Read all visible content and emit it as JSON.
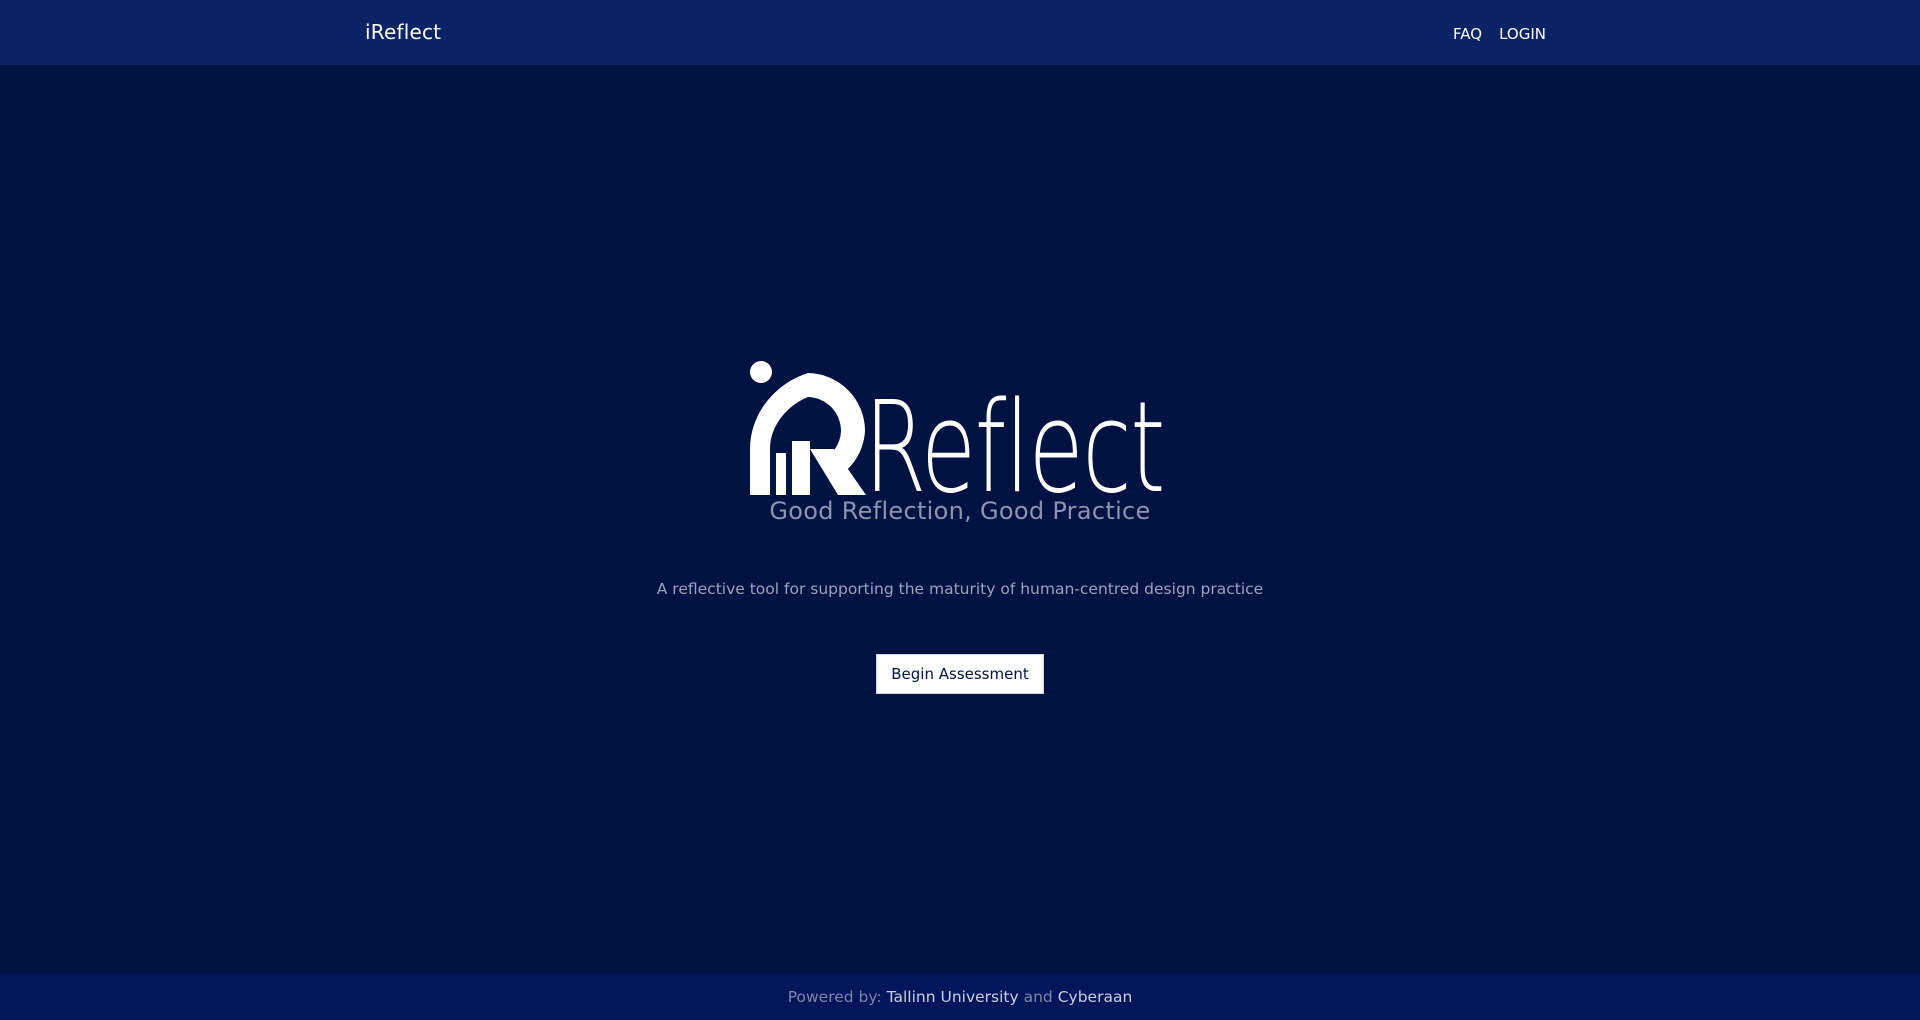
{
  "header": {
    "brand": "iReflect",
    "nav": [
      {
        "label": "FAQ"
      },
      {
        "label": "LOGIN"
      }
    ]
  },
  "hero": {
    "logo_text": "Reflect",
    "logo_icon": "ireflect-logo-icon",
    "tagline": "Good Reflection, Good Practice",
    "description": "A reflective tool for supporting the maturity of human-centred design practice",
    "cta_label": "Begin Assessment"
  },
  "footer": {
    "prefix": "Powered by:",
    "link1": "Tallinn University",
    "conjunction": "and",
    "link2": "Cyberaan"
  },
  "colors": {
    "background": "#001242",
    "header": "#0a2266",
    "footer": "#03165c",
    "accent_text": "#ffffff",
    "muted_text": "#8b95b3"
  }
}
